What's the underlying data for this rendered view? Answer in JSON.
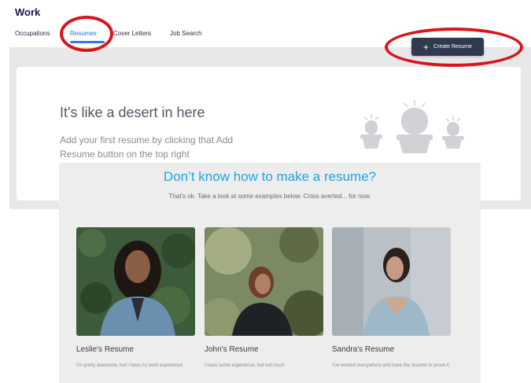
{
  "header": {
    "title": "Work"
  },
  "tabs": [
    {
      "label": "Occupations"
    },
    {
      "label": "Resumes"
    },
    {
      "label": "Cover Letters"
    },
    {
      "label": "Job Search"
    }
  ],
  "create_button": {
    "icon": "plus-icon",
    "label": "Create Resume"
  },
  "empty_state": {
    "title": "It's like a desert in here",
    "description": "Add your first resume by clicking that Add Resume button on the top right"
  },
  "examples": {
    "title": "Don’t know how to make a resume?",
    "subtitle": "That's ok. Take a look at some examples below. Crisis averted... for now.",
    "items": [
      {
        "name": "Leslie's Resume",
        "description": "I'm pretty awesome, but I have no work experience"
      },
      {
        "name": "John's Resume",
        "description": "I have some experience, but not much"
      },
      {
        "name": "Sandra's Resume",
        "description": "I've worked everywhere and have the resume to prove it"
      }
    ]
  },
  "colors": {
    "active_tab": "#1e6cff",
    "button_bg": "#2f3a4f",
    "annotation_circle": "#d9141b",
    "examples_title": "#1ea4e8"
  }
}
